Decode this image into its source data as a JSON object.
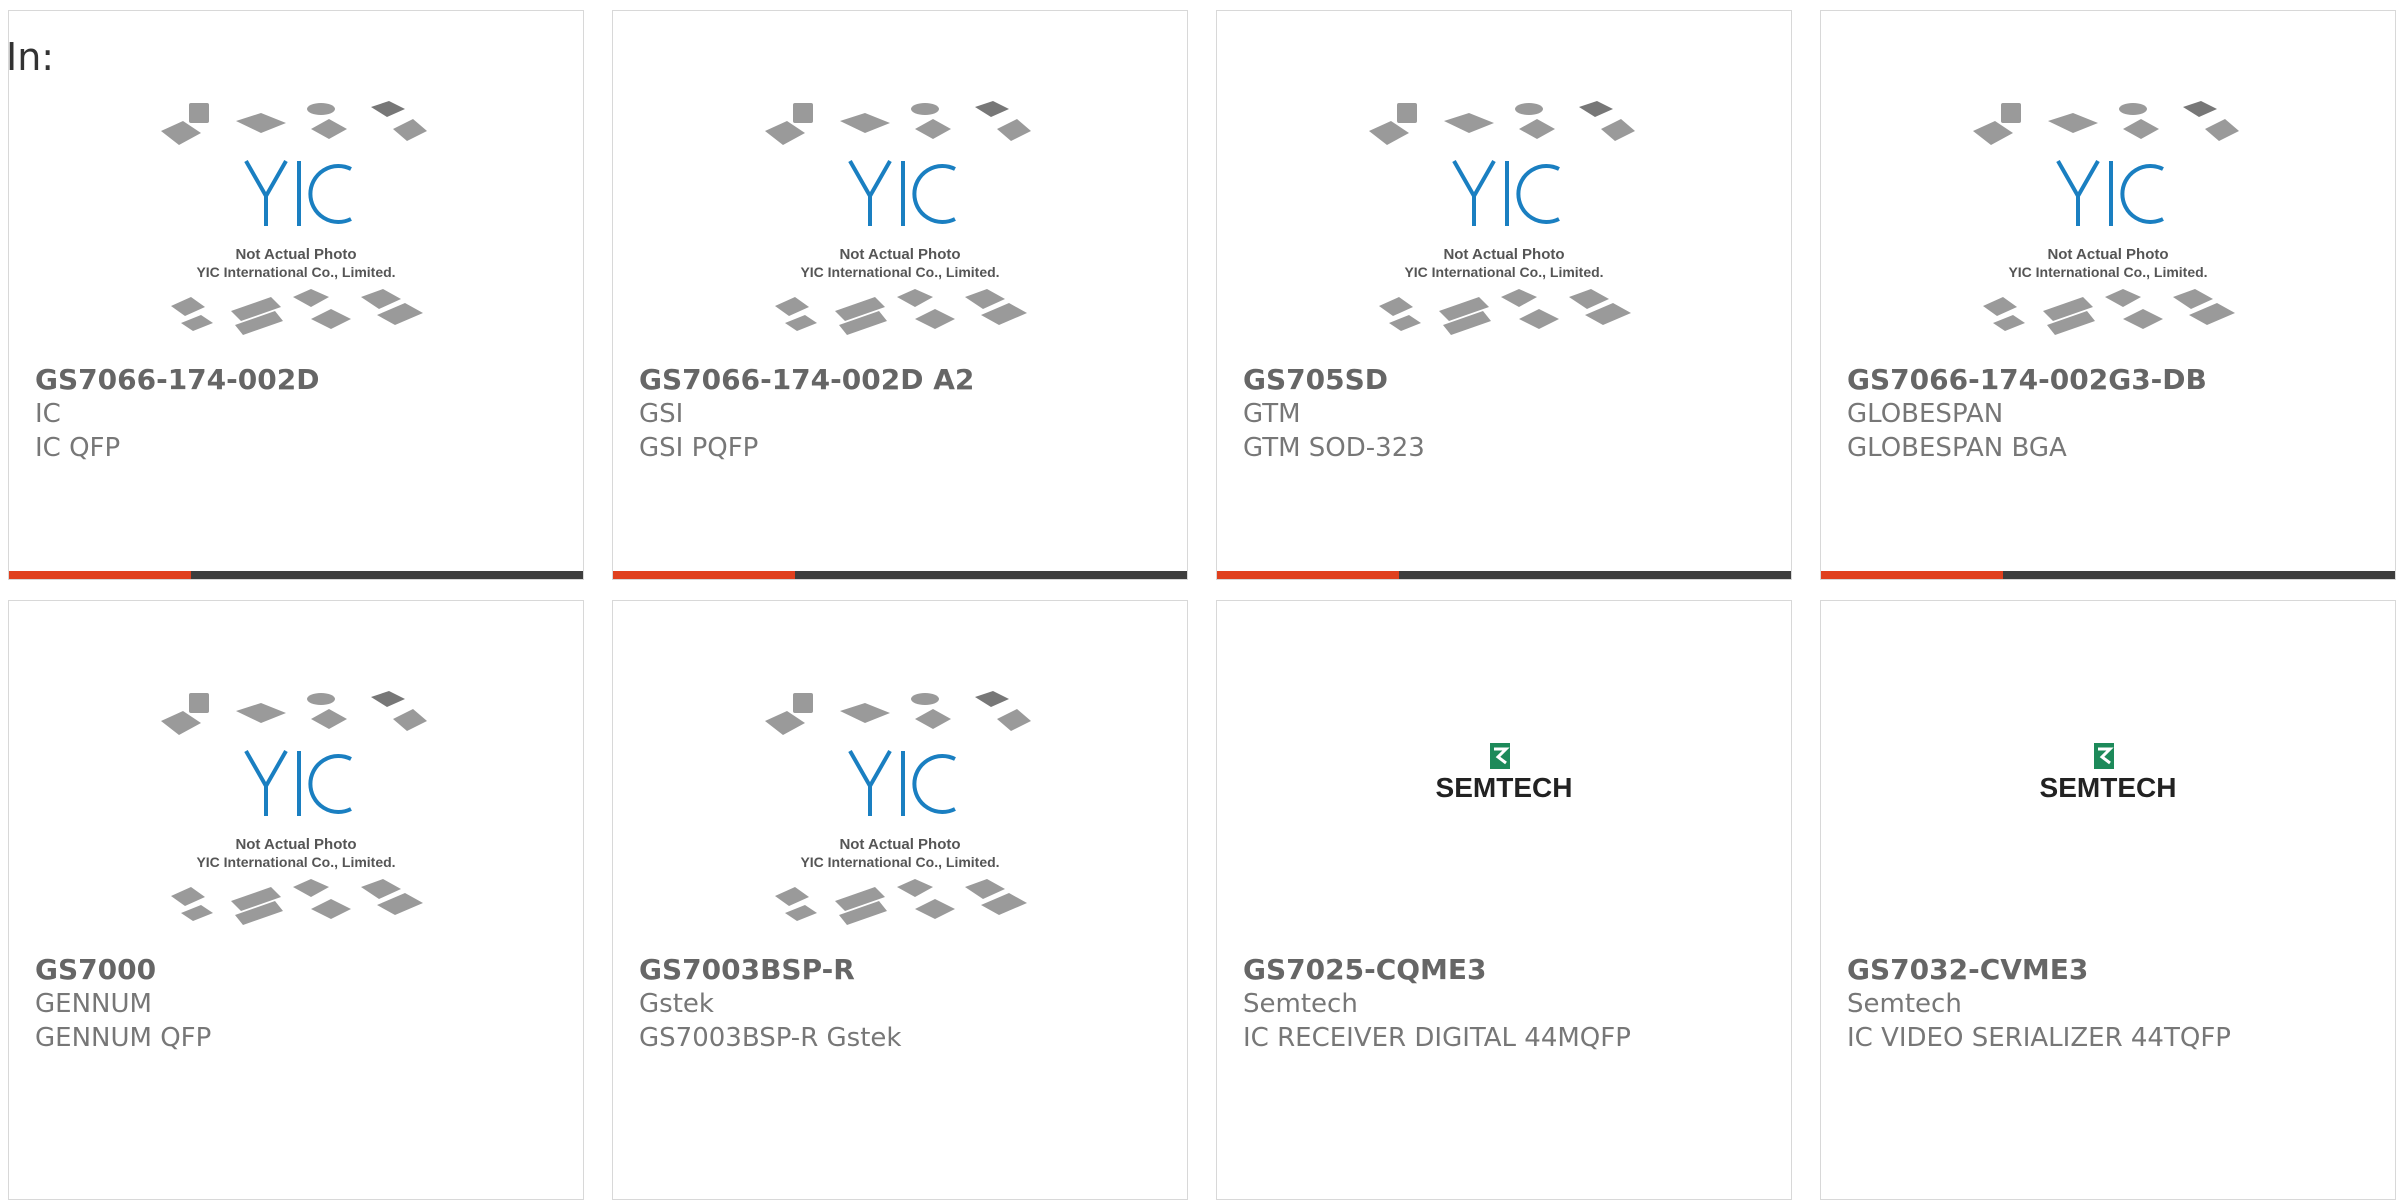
{
  "filter": {
    "label": "In:"
  },
  "placeholder_image": {
    "line1": "Not Actual Photo",
    "line2": "YIC International Co., Limited.",
    "logo": "YIC"
  },
  "semtech_logo": {
    "text": "SEMTECH"
  },
  "colors": {
    "accent": "#e0401e",
    "bar": "#3d3d3d",
    "yic_blue": "#1a7fc1",
    "semtech_green": "#1d8a5a"
  },
  "products": [
    {
      "part": "GS7066-174-002D",
      "manufacturer": "IC",
      "description": "IC QFP",
      "image": "placeholder"
    },
    {
      "part": "GS7066-174-002D A2",
      "manufacturer": "GSI",
      "description": "GSI PQFP",
      "image": "placeholder"
    },
    {
      "part": "GS705SD",
      "manufacturer": "GTM",
      "description": "GTM SOD-323",
      "image": "placeholder"
    },
    {
      "part": "GS7066-174-002G3-DB",
      "manufacturer": "GLOBESPAN",
      "description": "GLOBESPAN BGA",
      "image": "placeholder"
    },
    {
      "part": "GS7000",
      "manufacturer": "GENNUM",
      "description": "GENNUM QFP",
      "image": "placeholder"
    },
    {
      "part": "GS7003BSP-R",
      "manufacturer": "Gstek",
      "description": "GS7003BSP-R Gstek",
      "image": "placeholder"
    },
    {
      "part": "GS7025-CQME3",
      "manufacturer": "Semtech",
      "description": "IC RECEIVER DIGITAL 44MQFP",
      "image": "semtech"
    },
    {
      "part": "GS7032-CVME3",
      "manufacturer": "Semtech",
      "description": "IC VIDEO SERIALIZER 44TQFP",
      "image": "semtech"
    }
  ]
}
